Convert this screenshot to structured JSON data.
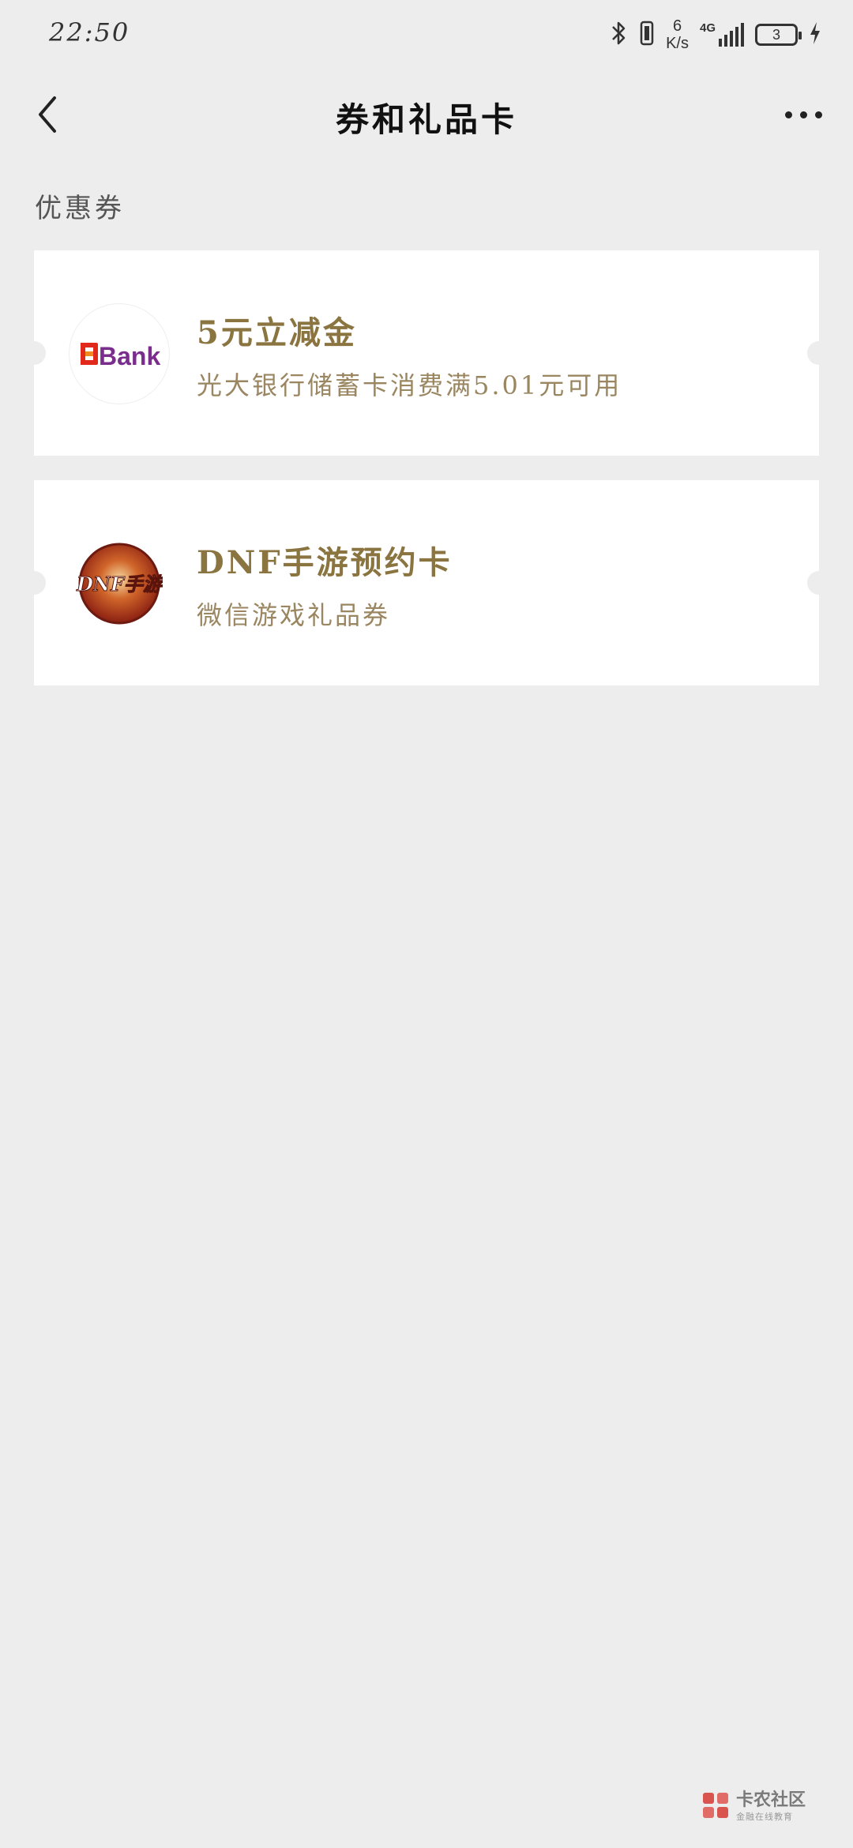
{
  "status_bar": {
    "time": "22:50",
    "net_speed_value": "6",
    "net_speed_unit": "K/s",
    "network_type": "4G",
    "battery_level": "3",
    "icons": [
      "bluetooth-icon",
      "vibrate-icon",
      "signal-icon",
      "battery-icon",
      "charging-icon"
    ]
  },
  "header": {
    "title": "券和礼品卡",
    "back_icon": "chevron-left-icon",
    "more_icon": "more-dots-icon"
  },
  "section": {
    "label": "优惠券"
  },
  "coupons": [
    {
      "title": "5元立减金",
      "subtitle": "光大银行储蓄卡消费满5.01元可用",
      "logo_text": "Bank",
      "logo_icon": "bank-logo-icon"
    },
    {
      "title": "DNF手游预约卡",
      "subtitle": "微信游戏礼品券",
      "logo_text": "DNF手游",
      "logo_icon": "dnf-game-logo-icon"
    }
  ],
  "watermark": {
    "title": "卡农社区",
    "subtitle": "金融在线教育"
  },
  "colors": {
    "background": "#ededed",
    "card": "#ffffff",
    "coupon_title": "#8a7440",
    "coupon_subtitle": "#9a8660"
  }
}
